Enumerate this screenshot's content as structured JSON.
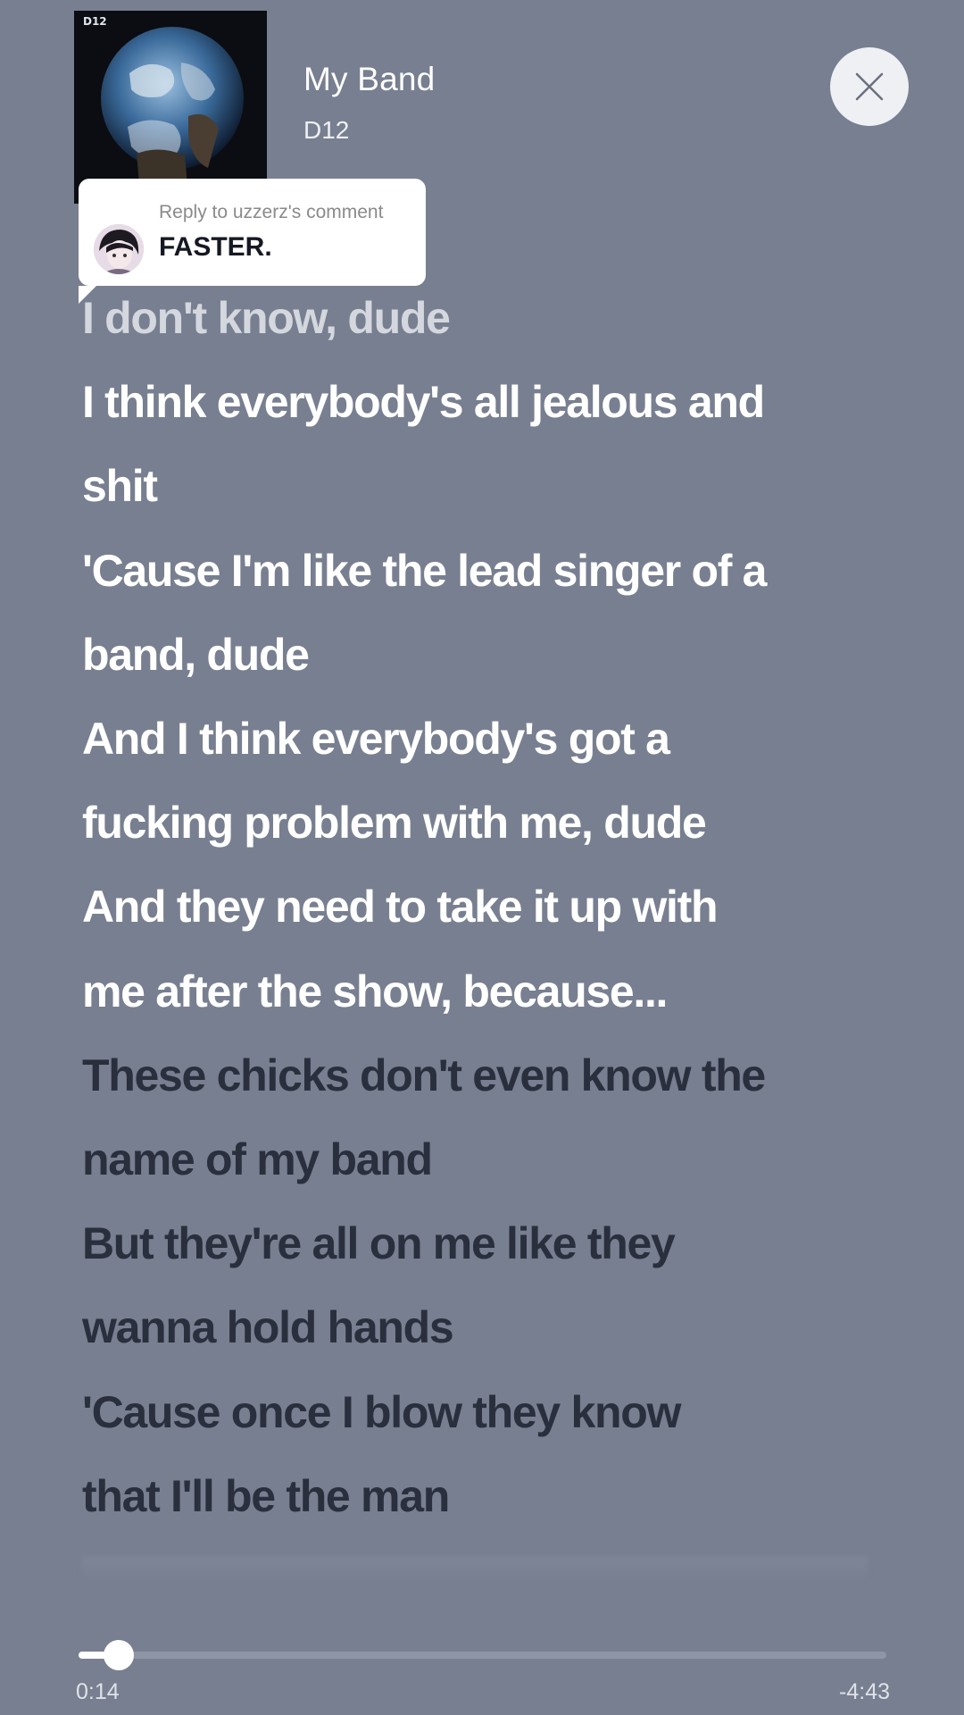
{
  "track": {
    "title": "My Band",
    "artist": "D12"
  },
  "comment": {
    "header": "Reply to uzzerz's comment",
    "text": "FASTER."
  },
  "lyrics": {
    "past": [
      "I don't know, dude"
    ],
    "current": [
      "I think everybody's all jealous and",
      "shit",
      "'Cause I'm like the lead singer of a",
      "band, dude",
      "And I think everybody's got a",
      "fucking problem with me, dude",
      "And they need to take it up with",
      "me after the show, because..."
    ],
    "upcoming": [
      "These chicks don't even know the",
      "name of my band",
      "But they're all on me like they",
      "wanna hold hands",
      "'Cause once I blow they know",
      "that I'll be the man"
    ]
  },
  "playback": {
    "elapsed": "0:14",
    "remaining": "-4:43",
    "progress": 0.05
  },
  "icons": {
    "close": "close-icon"
  }
}
